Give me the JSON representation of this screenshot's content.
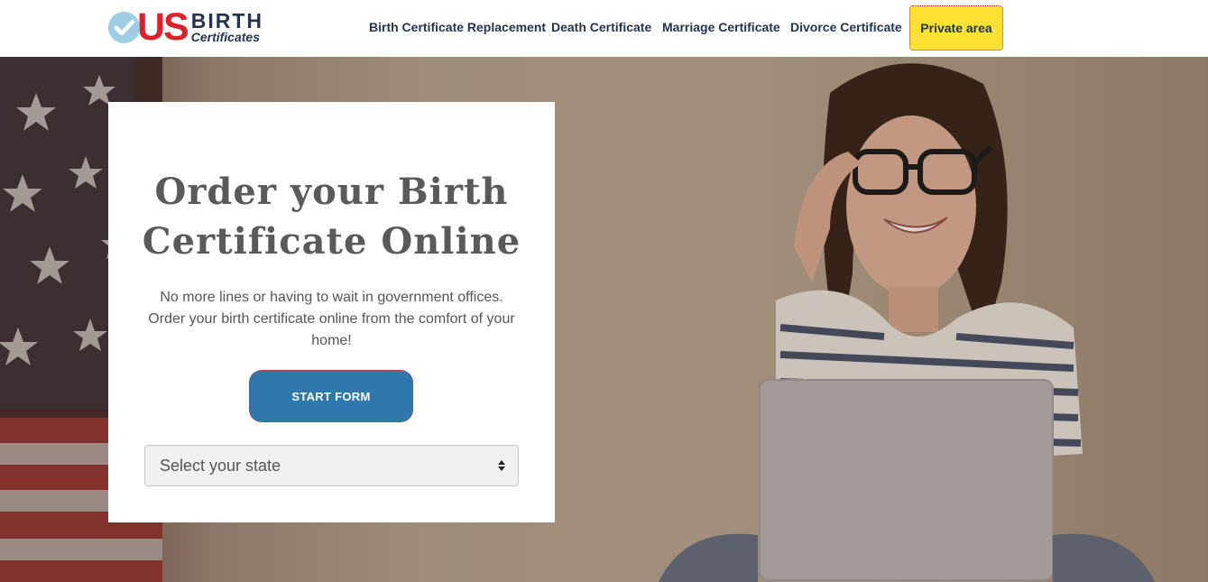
{
  "header": {
    "logo": {
      "us": "US",
      "birth": "BIRTH",
      "certificates": "Certificates"
    },
    "nav": [
      {
        "label": "Birth Certificate Replacement"
      },
      {
        "label": "Death Certificate"
      },
      {
        "label": "Marriage Certificate"
      },
      {
        "label": "Divorce Certificate"
      }
    ],
    "private_area_label": "Private area"
  },
  "hero": {
    "title_line1": "Order your Birth",
    "title_line2": "Certificate Online",
    "description_line1": "No more lines or having to wait in government offices.",
    "description_line2": "Order your birth certificate online from the comfort of your",
    "description_line3": "home!",
    "start_button_label": "START FORM",
    "state_select": {
      "selected": "Select your state"
    }
  },
  "colors": {
    "brand_red": "#d8232a",
    "brand_navy": "#24344f",
    "button_blue": "#2e78ad",
    "private_yellow": "#fde133"
  },
  "icons": [
    "check-icon",
    "select-arrows-icon"
  ]
}
